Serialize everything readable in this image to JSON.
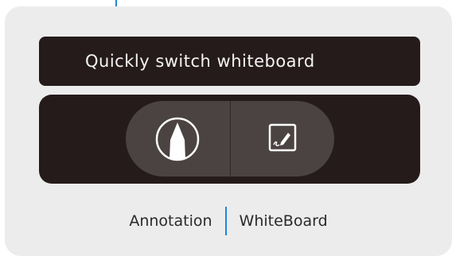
{
  "tip": {
    "text": "Quickly switch whiteboard"
  },
  "toolbar": {
    "buttons": [
      {
        "icon": "pen-icon",
        "mode": "annotation"
      },
      {
        "icon": "whiteboard-icon",
        "mode": "whiteboard"
      }
    ]
  },
  "labels": {
    "annotation": "Annotation",
    "whiteboard": "WhiteBoard"
  },
  "colors": {
    "accent": "#1e88d8",
    "panel": "#261b1b",
    "switch": "#4a4342",
    "background": "#ececec"
  }
}
